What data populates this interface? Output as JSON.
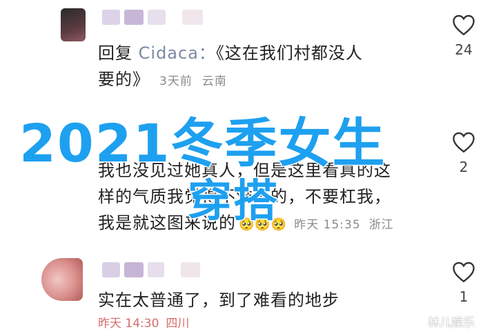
{
  "comments": [
    {
      "reply_prefix": "回复",
      "reply_target": "Cidaca：",
      "line1": "《这在我们村都没人",
      "line2": "要的》",
      "time": "3天前",
      "location": "云南",
      "likes": "24"
    },
    {
      "line1": "我也没见过她真人，但是这里看真的这",
      "line2": "样的气质我觉得不难看的，不要杠我，",
      "line3": "我是就这图来说的",
      "emoji": "🥺🥺🥺",
      "time": "昨天 15:35",
      "location": "浙江",
      "likes": "2"
    },
    {
      "line1": "实在太普通了，到了难看的地步",
      "time": "昨天 14:30",
      "location": "四川",
      "likes": "1"
    }
  ],
  "overlay": {
    "title": "2021冬季女生",
    "subtitle": "穿搭"
  },
  "watermark": "林儿娱乐",
  "colors": {
    "overlay_text": "#1ea0f0",
    "meta_text": "#8a8a8a",
    "mention": "#7a8aa6"
  },
  "icons": [
    "heart-outline-icon"
  ]
}
